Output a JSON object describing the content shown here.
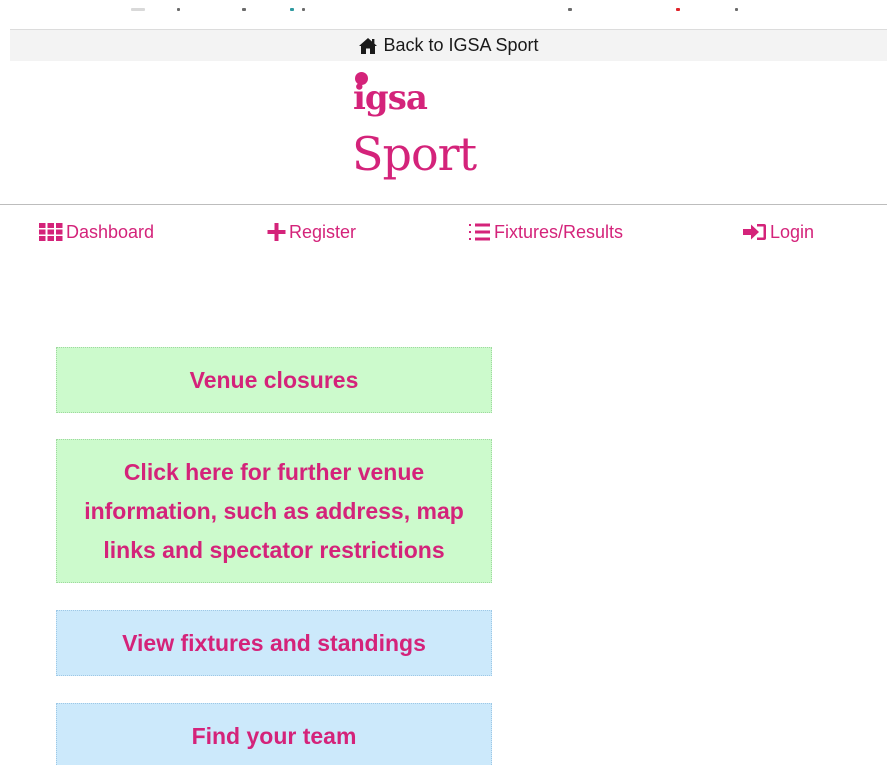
{
  "top_links": {
    "back_label": "Back to IGSA Sport"
  },
  "logo": {
    "line1": "igsa",
    "line2": "Sport",
    "brand_color": "#d4237a"
  },
  "nav": {
    "items": [
      {
        "label": "Dashboard",
        "icon": "grid-icon"
      },
      {
        "label": "Register",
        "icon": "plus-icon"
      },
      {
        "label": "Fixtures/Results",
        "icon": "list-icon"
      },
      {
        "label": "Login",
        "icon": "sign-in-icon"
      }
    ]
  },
  "cards": [
    {
      "label": "Venue closures",
      "color": "#ccfacc"
    },
    {
      "label": "Click here for further venue information, such as address, map links and spectator restrictions",
      "color": "#ccfacc"
    },
    {
      "label": "View fixtures and standings",
      "color": "#cce9fb"
    },
    {
      "label": "Find your team",
      "color": "#cce9fb"
    }
  ],
  "colors": {
    "accent": "#d4237a",
    "green_card": "#ccfacc",
    "blue_card": "#cce9fb",
    "back_bar": "#f3f3f3"
  }
}
